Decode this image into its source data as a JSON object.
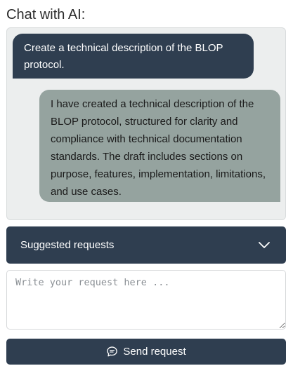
{
  "header": {
    "title": "Chat with AI:"
  },
  "chat": {
    "messages": [
      {
        "role": "user",
        "text": "Create a technical description of the BLOP protocol."
      },
      {
        "role": "assistant",
        "text": "I have created a technical description of the BLOP protocol, structured for clarity and compliance with technical documentation standards. The draft includes sections on purpose, features, implementation, limitations, and use cases."
      }
    ]
  },
  "suggested": {
    "label": "Suggested requests",
    "icon": "chevron-down-icon"
  },
  "input": {
    "placeholder": "Write your request here ...",
    "value": ""
  },
  "send_button": {
    "label": "Send request",
    "icon": "chat-bubble-icon"
  },
  "colors": {
    "primary": "#2f3e50",
    "assistant_bubble": "#95a39f",
    "panel_bg": "#eceeee"
  }
}
